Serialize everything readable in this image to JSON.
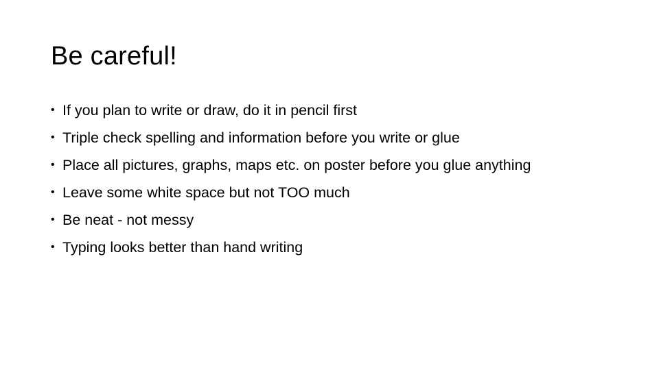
{
  "slide": {
    "title": "Be careful!",
    "bullet_glyph": "•",
    "bullets": [
      "If you plan to write or draw, do it in pencil first",
      "Triple check spelling and information before you write or glue",
      "Place all pictures, graphs, maps etc. on poster before you glue anything",
      "Leave some white space but not TOO much",
      "Be neat - not messy",
      "Typing looks better than hand writing"
    ]
  }
}
